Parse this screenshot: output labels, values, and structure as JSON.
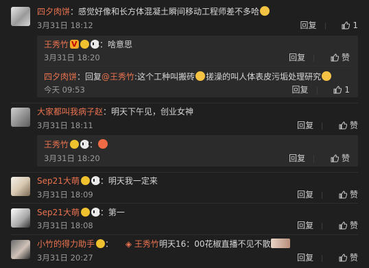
{
  "labels": {
    "reply": "回复",
    "like": "赞"
  },
  "comments": [
    {
      "user": "四夕肉饼",
      "text": "：感觉好像和长方体混凝土瞬间移动工程师差不多哈",
      "time": "3月31日 18:12",
      "likes": "1",
      "replies": [
        {
          "user": "王秀竹",
          "text": "：啥意思",
          "time": "3月31日 18:20",
          "likes": ""
        },
        {
          "user": "四夕肉饼",
          "prefix": "：回复",
          "mention": "@王秀竹",
          "text_a": ":这个工种叫搬砖",
          "text_b": "搓澡的叫人体表皮污垢处理研究",
          "time": "今天 09:53",
          "likes": "1"
        }
      ]
    },
    {
      "user": "大家都叫我病子赵",
      "text": "：明天下午见，创业女神",
      "time": "3月31日 18:11",
      "likes": "",
      "replies": [
        {
          "user": "王秀竹",
          "text": "：",
          "time": "3月31日 18:20",
          "likes": ""
        }
      ]
    },
    {
      "user": "Sep21大萌",
      "text": "：明天我一定来",
      "time": "3月31日 18:09",
      "likes": ""
    },
    {
      "user": "Sep21大萌",
      "text": "：第一",
      "time": "3月31日 18:08",
      "likes": ""
    },
    {
      "user": "小竹的得力助手",
      "text": "：",
      "mention": "王秀竹",
      "text_b": "明天16：00花椒直播不见不散",
      "time": "3月31日 20:27",
      "likes": ""
    }
  ]
}
